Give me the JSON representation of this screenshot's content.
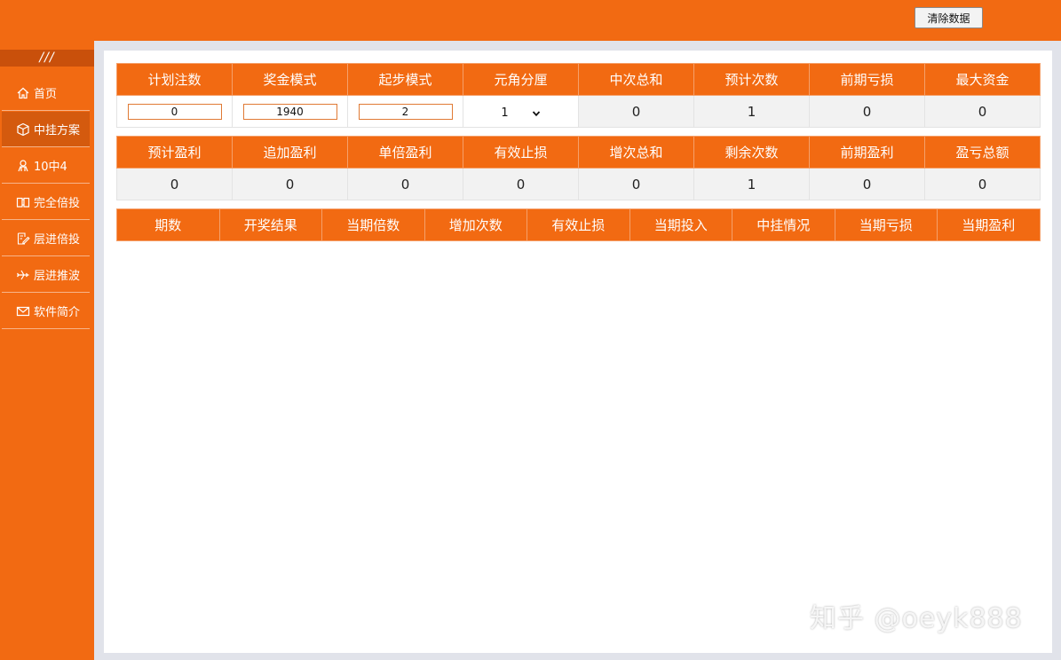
{
  "header": {
    "clear_button": "清除数据"
  },
  "sidebar": {
    "logo": "///",
    "items": [
      {
        "label": "首页",
        "icon": "home-icon"
      },
      {
        "label": "中挂方案",
        "icon": "box-icon"
      },
      {
        "label": "10中4",
        "icon": "person-icon"
      },
      {
        "label": "完全倍投",
        "icon": "book-icon"
      },
      {
        "label": "层进倍投",
        "icon": "edit-icon"
      },
      {
        "label": "层进推波",
        "icon": "plane-icon"
      },
      {
        "label": "软件简介",
        "icon": "mail-icon"
      }
    ]
  },
  "table1": {
    "headers": [
      "计划注数",
      "奖金模式",
      "起步模式",
      "元角分厘",
      "中次总和",
      "预计次数",
      "前期亏损",
      "最大资金"
    ],
    "inputs": [
      "0",
      "1940",
      "2"
    ],
    "select_value": "1",
    "values": [
      "0",
      "1",
      "0",
      "0"
    ]
  },
  "table2": {
    "headers": [
      "预计盈利",
      "追加盈利",
      "单倍盈利",
      "有效止损",
      "增次总和",
      "剩余次数",
      "前期盈利",
      "盈亏总额"
    ],
    "values": [
      "0",
      "0",
      "0",
      "0",
      "0",
      "1",
      "0",
      "0"
    ]
  },
  "table3": {
    "headers": [
      "期数",
      "开奖结果",
      "当期倍数",
      "增加次数",
      "有效止损",
      "当期投入",
      "中挂情况",
      "当期亏损",
      "当期盈利"
    ]
  },
  "watermark": "知乎 @oeyk888",
  "colors": {
    "accent": "#f26a12",
    "dark_accent": "#c9500b",
    "frame": "#e1e3ea"
  }
}
